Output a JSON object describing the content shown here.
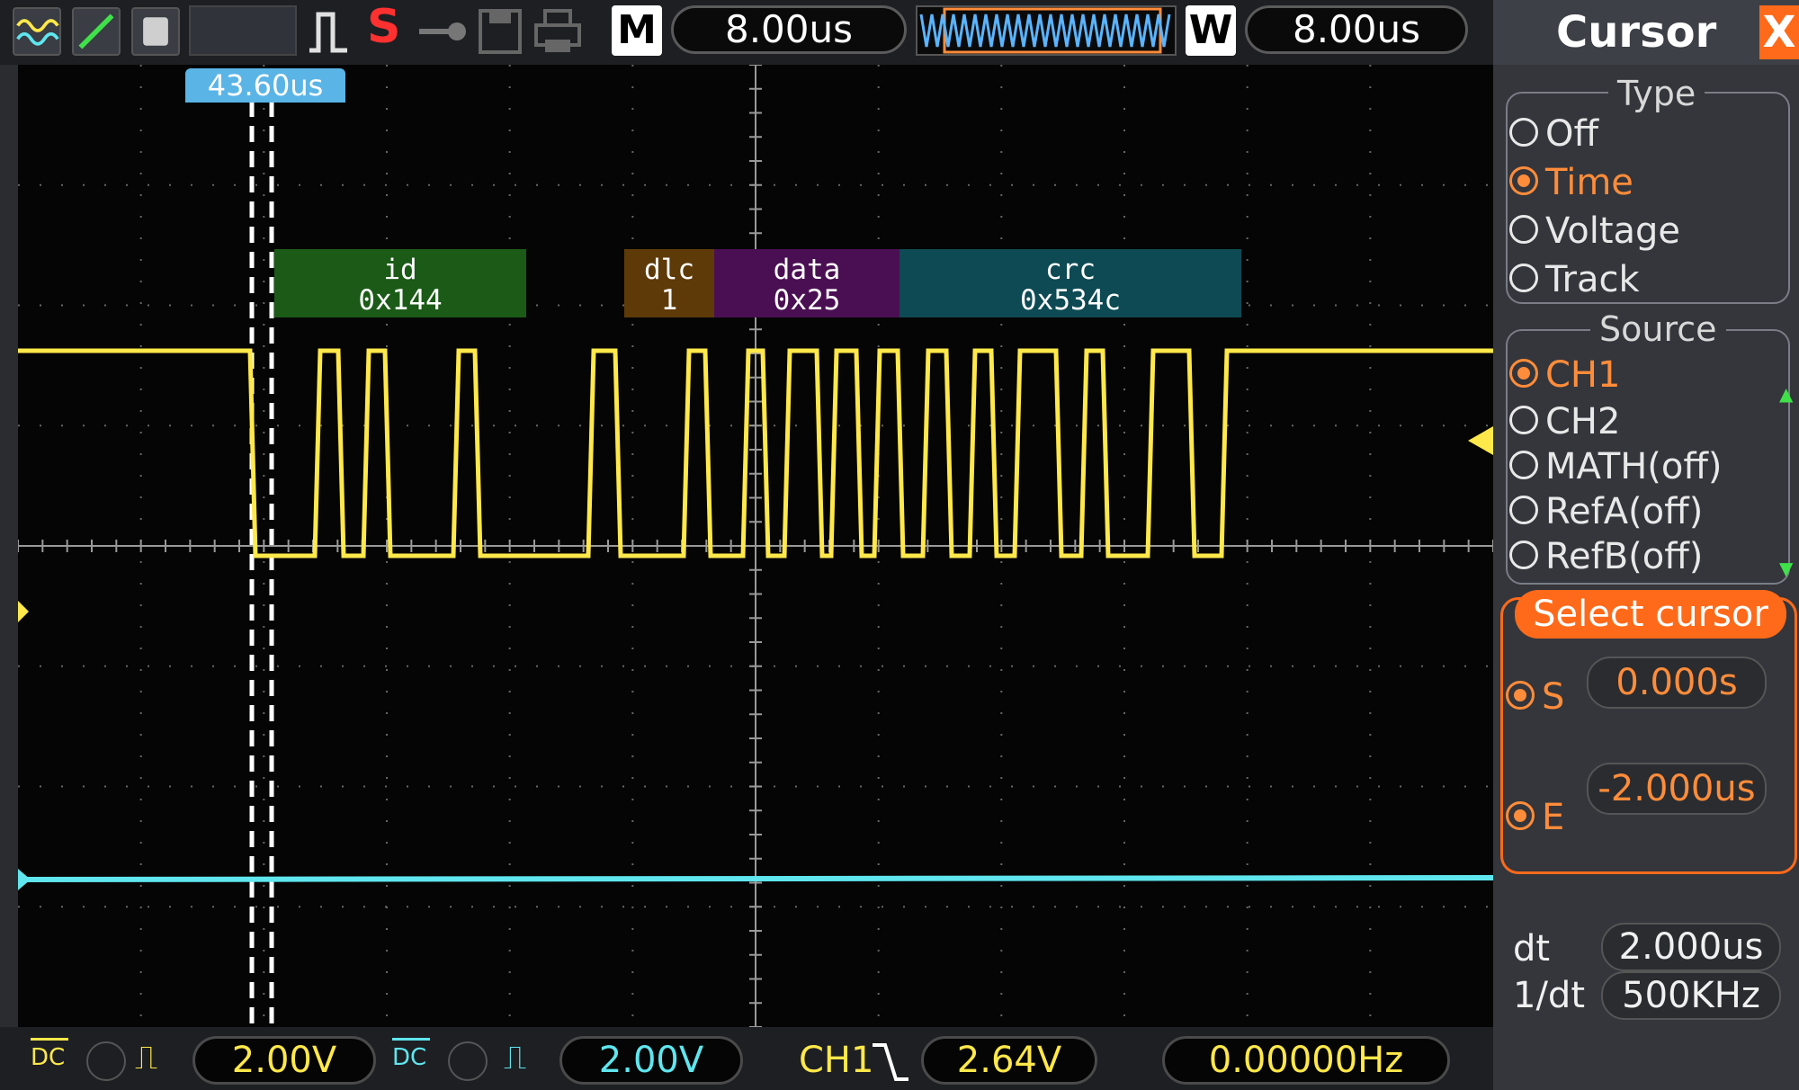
{
  "header": {
    "m_label": "M",
    "time_base": "8.00us",
    "w_label": "W",
    "window_time": "8.00us",
    "stop_indicator": "S"
  },
  "cursor": {
    "time_label": "43.60us"
  },
  "decode": [
    {
      "name": "id",
      "value": "0x144",
      "color": "#1b5b17"
    },
    {
      "name": "dlc",
      "value": "1",
      "color": "#5e3a08"
    },
    {
      "name": "data",
      "value": "0x25",
      "color": "#4a0f52"
    },
    {
      "name": "crc",
      "value": "0x534c",
      "color": "#0d4a53"
    }
  ],
  "colors": {
    "ch1": "#ffe84a",
    "ch2": "#5fe6ee",
    "cursor_label": "#5ab4e6",
    "accent": "#ff6a1a"
  },
  "bottom": {
    "ch1_coupling": "DC",
    "ch1_scale": "2.00V",
    "ch2_coupling": "DC",
    "ch2_scale": "2.00V",
    "trigger_source": "CH1",
    "trigger_level": "2.64V",
    "frequency": "0.00000Hz"
  },
  "panel": {
    "title": "Cursor",
    "close": "X",
    "type_title": "Type",
    "type_options": [
      "Off",
      "Time",
      "Voltage",
      "Track"
    ],
    "source_title": "Source",
    "source_options": [
      "CH1",
      "CH2",
      "MATH(off)",
      "RefA(off)",
      "RefB(off)"
    ],
    "select_title": "Select cursor",
    "s_label": "S",
    "s_value": "0.000s",
    "e_label": "E",
    "e_value": "-2.000us",
    "dt_label": "dt",
    "dt_value": "2.000us",
    "inv_dt_label": "1/dt",
    "inv_dt_value": "500KHz"
  }
}
